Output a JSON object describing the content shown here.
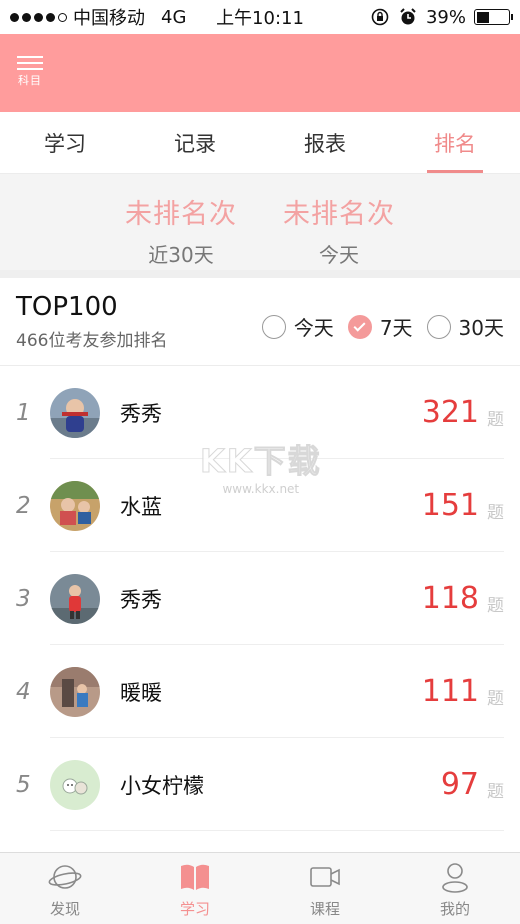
{
  "status_bar": {
    "carrier": "中国移动",
    "network": "4G",
    "time": "上午10:11",
    "battery_percent": "39%",
    "battery_level": 0.39,
    "signal_bars": 4
  },
  "header": {
    "menu_label": "科目",
    "background_color": "#ff9c9c"
  },
  "tabs": [
    {
      "label": "学习",
      "active": false
    },
    {
      "label": "记录",
      "active": false
    },
    {
      "label": "报表",
      "active": false
    },
    {
      "label": "排名",
      "active": true
    }
  ],
  "summary": [
    {
      "value": "未排名次",
      "label": "近30天"
    },
    {
      "value": "未排名次",
      "label": "今天"
    }
  ],
  "ranking": {
    "title": "TOP100",
    "subtitle": "466位考友参加排名",
    "filters": [
      {
        "label": "今天",
        "checked": false
      },
      {
        "label": "7天",
        "checked": true
      },
      {
        "label": "30天",
        "checked": false
      }
    ],
    "unit": "题",
    "rows": [
      {
        "rank": "1",
        "name": "秀秀",
        "score": "321",
        "avatar": "avatar-photo"
      },
      {
        "rank": "2",
        "name": "水蓝",
        "score": "151",
        "avatar": "avatar-photo"
      },
      {
        "rank": "3",
        "name": "秀秀",
        "score": "118",
        "avatar": "avatar-photo"
      },
      {
        "rank": "4",
        "name": "暖暖",
        "score": "111",
        "avatar": "avatar-photo"
      },
      {
        "rank": "5",
        "name": "小女柠檬",
        "score": "97",
        "avatar": "avatar-illustration"
      }
    ]
  },
  "watermark": {
    "logo": "KK下载",
    "url": "www.kkx.net"
  },
  "bottom_nav": [
    {
      "label": "发现",
      "icon": "planet-icon",
      "active": false
    },
    {
      "label": "学习",
      "icon": "book-icon",
      "active": true
    },
    {
      "label": "课程",
      "icon": "video-camera-icon",
      "active": false
    },
    {
      "label": "我的",
      "icon": "user-icon",
      "active": false
    }
  ],
  "colors": {
    "accent": "#f08b8b",
    "score": "#e53d3d",
    "summary_value": "#f3a2a2"
  }
}
